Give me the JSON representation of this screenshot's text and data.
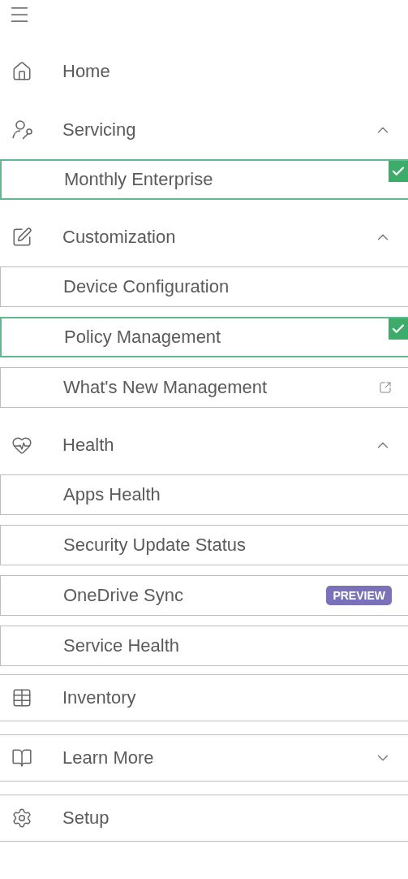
{
  "nav": [
    {
      "kind": "link",
      "label": "Home",
      "boxed": false
    },
    {
      "kind": "group",
      "label": "Servicing",
      "expanded": true,
      "boxed": false,
      "children": [
        {
          "kind": "item",
          "label": "Monthly Enterprise",
          "selected": true
        }
      ]
    },
    {
      "kind": "group",
      "label": "Customization",
      "expanded": true,
      "boxed": false,
      "children": [
        {
          "kind": "item",
          "label": "Device Configuration",
          "selected": false
        },
        {
          "kind": "item",
          "label": "Policy Management",
          "selected": true
        },
        {
          "kind": "external",
          "label": "What's New Management",
          "selected": false
        }
      ]
    },
    {
      "kind": "group",
      "label": "Health",
      "expanded": true,
      "boxed": false,
      "children": [
        {
          "kind": "item",
          "label": "Apps Health",
          "selected": false
        },
        {
          "kind": "item",
          "label": "Security Update Status",
          "selected": false
        },
        {
          "kind": "item",
          "label": "OneDrive Sync",
          "selected": false,
          "badge": "PREVIEW"
        },
        {
          "kind": "item",
          "label": "Service Health",
          "selected": false
        }
      ]
    },
    {
      "kind": "link",
      "label": "Inventory",
      "boxed": true
    },
    {
      "kind": "group",
      "label": "Learn More",
      "expanded": false,
      "boxed": true
    },
    {
      "kind": "link",
      "label": "Setup",
      "boxed": true
    }
  ]
}
